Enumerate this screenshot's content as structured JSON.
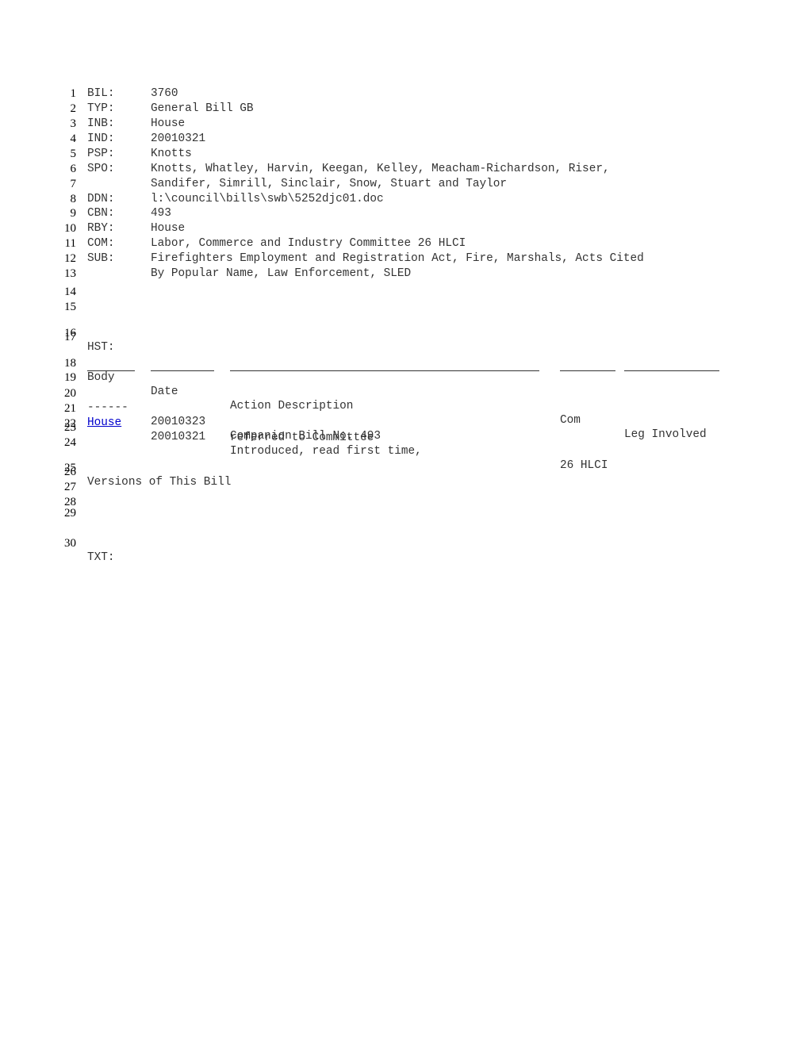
{
  "fields": [
    {
      "n": "1",
      "key": "BIL:",
      "value": "3760"
    },
    {
      "n": "2",
      "key": "TYP:",
      "value": "General Bill GB"
    },
    {
      "n": "3",
      "key": "INB:",
      "value": "House"
    },
    {
      "n": "4",
      "key": "IND:",
      "value": "20010321"
    },
    {
      "n": "5",
      "key": "PSP:",
      "value": "Knotts"
    },
    {
      "n": "6",
      "key": "SPO:",
      "value": "Knotts, Whatley, Harvin, Keegan, Kelley, Meacham-Richardson, Riser,"
    },
    {
      "n": "7",
      "key": "",
      "value": "Sandifer, Simrill, Sinclair, Snow, Stuart and Taylor"
    },
    {
      "n": "8",
      "key": "DDN:",
      "value": "l:\\council\\bills\\swb\\5252djc01.doc"
    },
    {
      "n": "9",
      "key": "CBN:",
      "value": "493"
    },
    {
      "n": "10",
      "key": "RBY:",
      "value": "House"
    },
    {
      "n": "11",
      "key": "COM:",
      "value": "Labor, Commerce and Industry Committee 26 HLCI"
    },
    {
      "n": "12",
      "key": "SUB:",
      "value": "Firefighters Employment and Registration Act, Fire, Marshals, Acts Cited"
    },
    {
      "n": "13",
      "key": "",
      "value": "By Popular Name, Law Enforcement, SLED"
    }
  ],
  "line_numbers": {
    "l14": "14",
    "l15": "15",
    "l16": "16",
    "l17": "17",
    "l18": "18",
    "l19": "19",
    "l20": "20",
    "l21": "21",
    "l22": "22",
    "l23": "23",
    "l24": "24",
    "l25": "25",
    "l26": "26",
    "l27": "27",
    "l28": "28",
    "l29": "29",
    "l30": "30"
  },
  "history": {
    "label": "HST:",
    "headers": {
      "body": "Body",
      "date": "Date",
      "action": "Action Description",
      "com": "Com",
      "leg": "Leg Involved"
    },
    "rows": [
      {
        "body": "------",
        "date": "20010323",
        "action": "Companion Bill No. 493",
        "com": "",
        "leg": ""
      },
      {
        "body": "House",
        "date": "20010321",
        "action": "Introduced, read first time,",
        "action_cont": "referred to Committee",
        "com": "26 HLCI",
        "leg": ""
      }
    ]
  },
  "versions_label": "Versions of This Bill",
  "text_label": "TXT:",
  "colors": {
    "link": "#0000cc",
    "text": "#333333"
  }
}
